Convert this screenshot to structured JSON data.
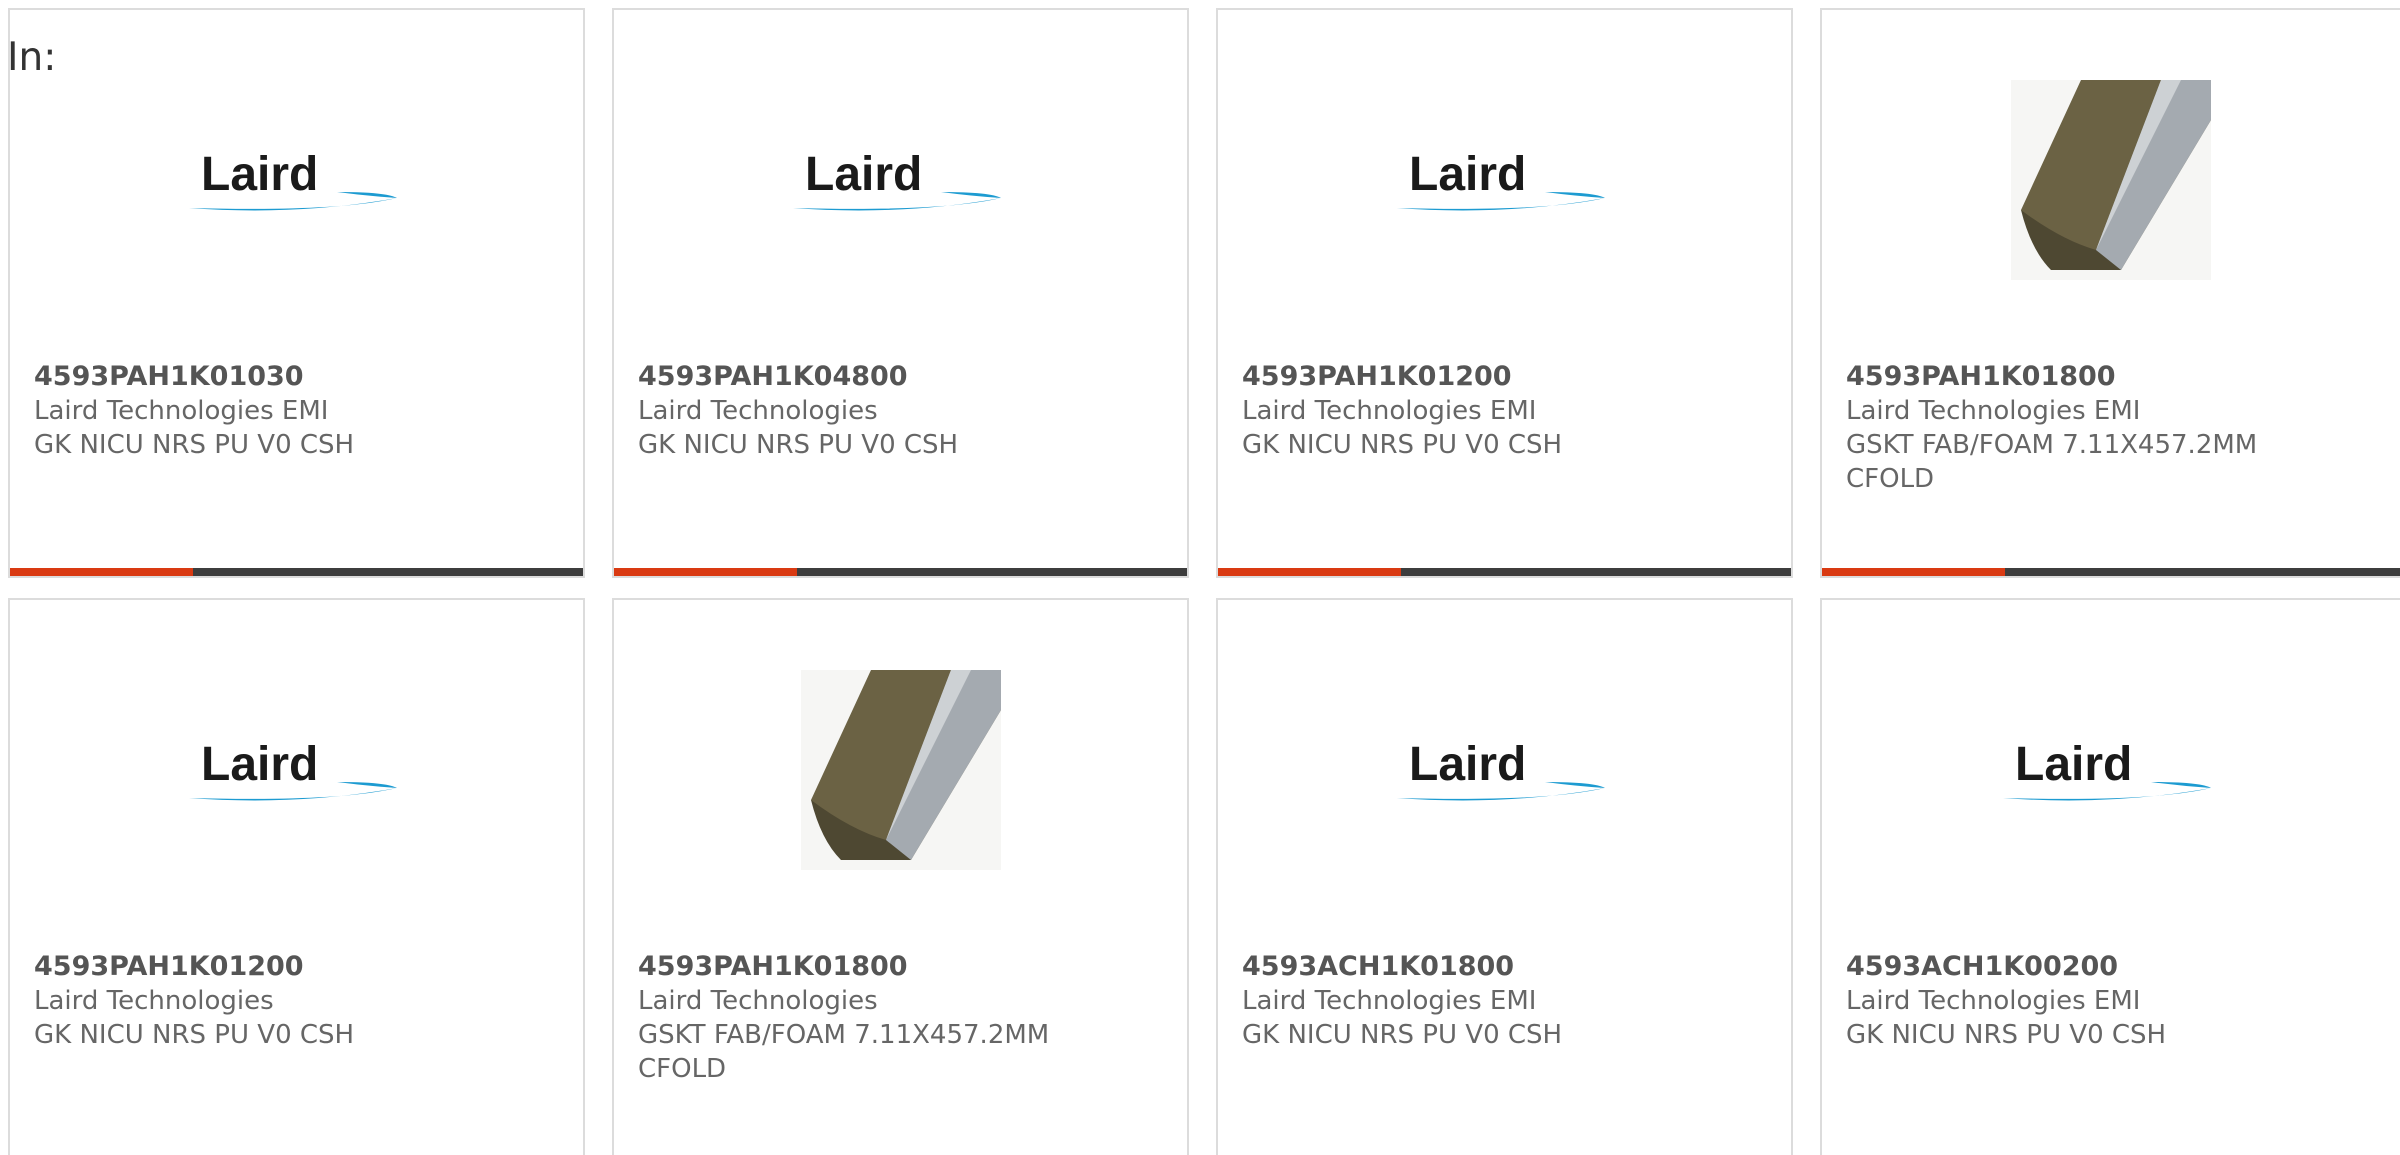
{
  "filter_label": "In:",
  "cards": [
    {
      "part_number": "4593PAH1K01030",
      "manufacturer": "Laird Technologies EMI",
      "description": "GK NICU NRS PU V0 CSH",
      "image": "laird-logo"
    },
    {
      "part_number": "4593PAH1K04800",
      "manufacturer": "Laird Technologies",
      "description": "GK NICU NRS PU V0 CSH",
      "image": "laird-logo"
    },
    {
      "part_number": "4593PAH1K01200",
      "manufacturer": "Laird Technologies EMI",
      "description": "GK NICU NRS PU V0 CSH",
      "image": "laird-logo"
    },
    {
      "part_number": "4593PAH1K01800",
      "manufacturer": "Laird Technologies EMI",
      "description": "GSKT FAB/FOAM 7.11X457.2MM CFOLD",
      "image": "gasket-photo"
    },
    {
      "part_number": "4593PAH1K01200",
      "manufacturer": "Laird Technologies",
      "description": "GK NICU NRS PU V0 CSH",
      "image": "laird-logo"
    },
    {
      "part_number": "4593PAH1K01800",
      "manufacturer": "Laird Technologies",
      "description": "GSKT FAB/FOAM 7.11X457.2MM CFOLD",
      "image": "gasket-photo"
    },
    {
      "part_number": "4593ACH1K01800",
      "manufacturer": "Laird Technologies EMI",
      "description": "GK NICU NRS PU V0 CSH",
      "image": "laird-logo"
    },
    {
      "part_number": "4593ACH1K00200",
      "manufacturer": "Laird Technologies EMI",
      "description": "GK NICU NRS PU V0 CSH",
      "image": "laird-logo"
    }
  ],
  "logo_text": "Laird",
  "colors": {
    "accent": "#d93a12",
    "bar": "#3d3d3d",
    "logo_swoosh": "#1d9bd1"
  }
}
